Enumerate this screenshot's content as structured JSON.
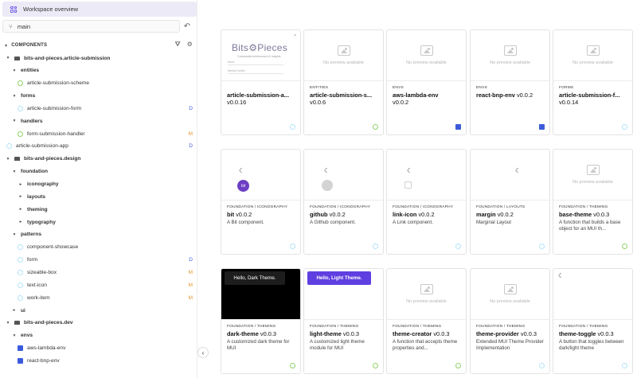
{
  "sidebar": {
    "workspace_label": "Workspace overview",
    "lane": "main",
    "components_header": "COMPONENTS",
    "tree": [
      {
        "label": "bits-and-pieces.article-submission",
        "type": "scope",
        "status": ""
      },
      {
        "label": "entities",
        "type": "folder",
        "status": ""
      },
      {
        "label": "article-submission-scheme",
        "type": "env-green",
        "status": ""
      },
      {
        "label": "forms",
        "type": "folder",
        "status": ""
      },
      {
        "label": "article-submission-form",
        "type": "react",
        "status": "D"
      },
      {
        "label": "handlers",
        "type": "folder",
        "status": ""
      },
      {
        "label": "form-submission-handler",
        "type": "env-green",
        "status": "M"
      },
      {
        "label": "article-submission-app",
        "type": "react",
        "status": "D"
      },
      {
        "label": "bits-and-pieces.design",
        "type": "scope",
        "status": ""
      },
      {
        "label": "foundation",
        "type": "folder",
        "status": ""
      },
      {
        "label": "iconography",
        "type": "folder-collapsed",
        "status": ""
      },
      {
        "label": "layouts",
        "type": "folder-collapsed",
        "status": ""
      },
      {
        "label": "theming",
        "type": "folder-collapsed",
        "status": ""
      },
      {
        "label": "typography",
        "type": "folder-collapsed",
        "status": ""
      },
      {
        "label": "patterns",
        "type": "folder",
        "status": ""
      },
      {
        "label": "component-showcase",
        "type": "react",
        "status": ""
      },
      {
        "label": "form",
        "type": "react",
        "status": "D"
      },
      {
        "label": "sizeable-box",
        "type": "react",
        "status": "M"
      },
      {
        "label": "text-icon",
        "type": "react",
        "status": "M"
      },
      {
        "label": "work-item",
        "type": "react",
        "status": "M"
      },
      {
        "label": "ui",
        "type": "folder-collapsed",
        "status": ""
      },
      {
        "label": "bits-and-pieces.dev",
        "type": "scope",
        "status": ""
      },
      {
        "label": "envs",
        "type": "folder",
        "status": ""
      },
      {
        "label": "aws-lambda-env",
        "type": "puzzle",
        "status": ""
      },
      {
        "label": "react-bnp-env",
        "type": "puzzle",
        "status": ""
      }
    ]
  },
  "cards": [
    {
      "namespace": "",
      "name": "article-submission-a...",
      "version": "v0.0.16",
      "desc": "",
      "preview": "bits",
      "env": "react"
    },
    {
      "namespace": "ENTITIES",
      "name": "article-submission-s...",
      "version": "v0.0.6",
      "desc": "",
      "preview": "none",
      "env": "green"
    },
    {
      "namespace": "ENVS",
      "name": "aws-lambda-env",
      "version": "v0.0.2",
      "desc": "",
      "preview": "none",
      "env": "puzzle"
    },
    {
      "namespace": "ENVS",
      "name": "react-bnp-env",
      "version": "v0.0.2",
      "desc": "",
      "preview": "none",
      "env": "puzzle"
    },
    {
      "namespace": "FORMS",
      "name": "article-submission-f...",
      "version": "v0.0.14",
      "desc": "",
      "preview": "none",
      "env": "react"
    },
    {
      "namespace": "FOUNDATION / ICONOGRAPHY",
      "name": "bit",
      "version": "v0.0.2",
      "desc": "A Bit component.",
      "preview": "bit",
      "env": "react"
    },
    {
      "namespace": "FOUNDATION / ICONOGRAPHY",
      "name": "github",
      "version": "v0.0.2",
      "desc": "A Github component.",
      "preview": "github",
      "env": "react"
    },
    {
      "namespace": "FOUNDATION / ICONOGRAPHY",
      "name": "link-icon",
      "version": "v0.0.2",
      "desc": "A Link component.",
      "preview": "link",
      "env": "react"
    },
    {
      "namespace": "FOUNDATION / LAYOUTS",
      "name": "margin",
      "version": "v0.0.2",
      "desc": "Marginal Layout",
      "preview": "moon-only",
      "env": "react"
    },
    {
      "namespace": "FOUNDATION / THEMING",
      "name": "base-theme",
      "version": "v0.0.3",
      "desc": "A function that builds a base object for an MUI th...",
      "preview": "none",
      "env": "green"
    },
    {
      "namespace": "FOUNDATION / THEMING",
      "name": "dark-theme",
      "version": "v0.0.3",
      "desc": "A customized dark theme for MUI",
      "preview": "dark",
      "env": "green"
    },
    {
      "namespace": "FOUNDATION / THEMING",
      "name": "light-theme",
      "version": "v0.0.3",
      "desc": "A customized light theme module for MUI",
      "preview": "light",
      "env": "green"
    },
    {
      "namespace": "FOUNDATION / THEMING",
      "name": "theme-creator",
      "version": "v0.0.3",
      "desc": "A function that accepts theme properties and...",
      "preview": "none",
      "env": "green"
    },
    {
      "namespace": "FOUNDATION / THEMING",
      "name": "theme-provider",
      "version": "v0.0.3",
      "desc": "Extended MUI Theme Provider Implementation",
      "preview": "none",
      "env": "react"
    },
    {
      "namespace": "FOUNDATION / THEMING",
      "name": "theme-toggle",
      "version": "v0.0.3",
      "desc": "A button that toggles between dark/light theme",
      "preview": "moon-corner",
      "env": "react"
    }
  ],
  "preview_text": {
    "no_preview": "No preview available",
    "bits_logo": "Bits⚙Pieces",
    "bits_tag": "Comparable achievement & Insights",
    "bits_field1": "Name",
    "bits_field2": "Medium handle",
    "dark_button": "Hello, Dark Theme.",
    "light_button": "Hello, Light Theme.",
    "bit_badge": "bit"
  },
  "colors": {
    "accent": "#6c5ce7",
    "status_D": "#3a5bd9",
    "status_M": "#e69532",
    "react_env": "#61c7f2",
    "green_env": "#8fd36a",
    "puzzle_env": "#3b5bdb"
  },
  "icons": {
    "collapse": "chevron-left-icon",
    "moon": "moon-icon",
    "filter": "filter-icon",
    "settings": "settings-icon",
    "undo": "undo-icon"
  }
}
